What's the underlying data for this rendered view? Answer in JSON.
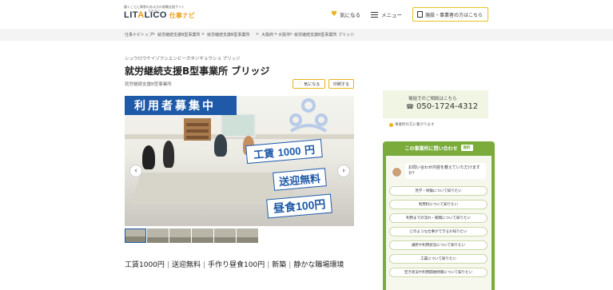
{
  "header": {
    "tagline": "働くことに障害のある方の就職支援サイト",
    "logo_main_1": "LIT",
    "logo_main_a": "A",
    "logo_main_2": "LICO",
    "logo_ruby": "りたりこ",
    "logo_sub": "仕事ナビ",
    "favorites_label": "気になる",
    "menu_label": "メニュー",
    "business_link": "施設・事業者の方はこちら"
  },
  "breadcrumb": [
    "仕事ナビトップ",
    "就労継続支援B型事業所",
    "就労継続支援B型事業所",
    "大阪府",
    "大阪市",
    "就労継続支援B型事業所 ブリッジ"
  ],
  "facility": {
    "kana": "シュウロウケイゾクシエンビーガタジギョウショ ブリッジ",
    "title": "就労継続支援B型事業所 ブリッジ",
    "category": "就労継続支援B型事業所",
    "fav_button": "気になる",
    "print_button": "印刷する"
  },
  "hero": {
    "banner": "利用者募集中",
    "stamp1_a": "工賃",
    "stamp1_n": "1000",
    "stamp1_b": "円",
    "stamp2": "送迎無料",
    "stamp3_a": "昼食",
    "stamp3_n": "100",
    "stamp3_b": "円",
    "prev": "‹",
    "next": "›",
    "thumbnail_count": 6
  },
  "features": [
    "工賃1000円",
    "送迎無料",
    "手作り昼食100円",
    "新築",
    "静かな職場環境"
  ],
  "contact": {
    "phone_label": "電話でのご相談はこちら",
    "phone_number": "050-1724-4312",
    "note": "事業所の方に繋がります"
  },
  "inquiry": {
    "header": "この事業所に問い合わせ",
    "free_badge": "無料",
    "prompt": "お問い合わせ内容を教えていただけますか？",
    "questions": [
      "見学・体験について知りたい",
      "利用料について知りたい",
      "利用までの流れ・期間について知りたい",
      "どのような仕事ができるか知りたい",
      "通所や利用状況について知りたい",
      "工賃について知りたい",
      "空き状況や利用開始時期について知りたい"
    ]
  },
  "colors": {
    "accent_yellow": "#e9b21c",
    "brand_blue": "#1f5aa8",
    "inquiry_green": "#7aab3b",
    "contact_bg": "#f1f5e4"
  }
}
